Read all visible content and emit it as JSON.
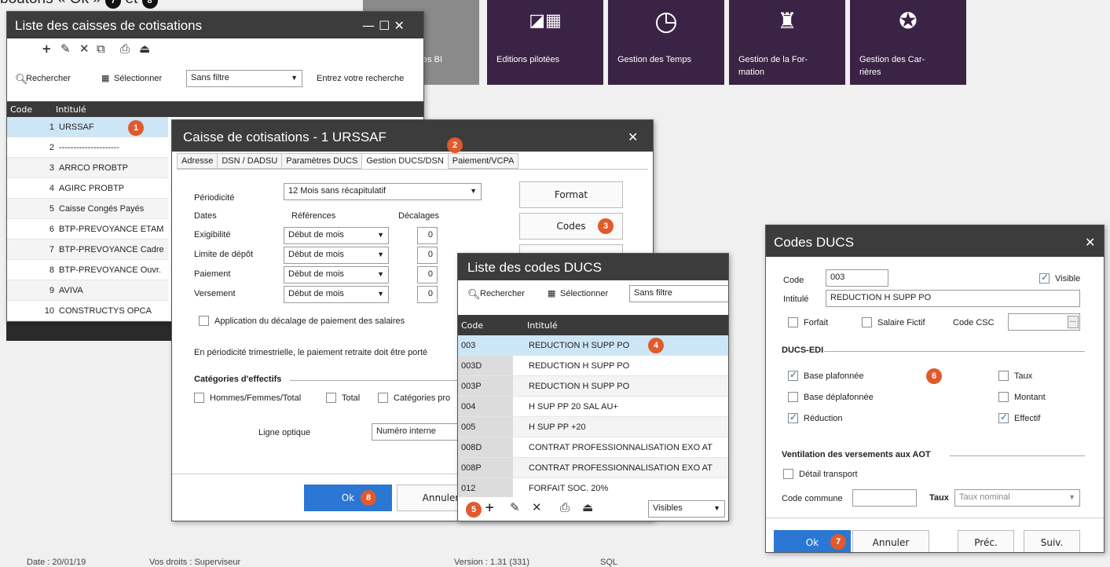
{
  "caption_top": "boutons « Ok »",
  "caption_badge_a": "7",
  "caption_et": "et",
  "caption_badge_b": "8",
  "tiles": [
    {
      "label": "es BI",
      "icon": ""
    },
    {
      "label": "Editions pilotées",
      "icon": "◪▦"
    },
    {
      "label": "Gestion des Temps",
      "icon": "◷"
    },
    {
      "label": "Gestion de la For- mation",
      "icon": "♜"
    },
    {
      "label": "Gestion des Car- rières",
      "icon": "✪"
    }
  ],
  "footer": {
    "date": "Date : 20/01/19",
    "rights": "Vos droits : Superviseur",
    "version": "Version : 1.31 (331)",
    "sql": "SQL"
  },
  "caisses": {
    "title": "Liste des caisses de cotisations",
    "win_controls": "— ☐ ✕",
    "search_label": "Rechercher",
    "select_label": "Sélectionner",
    "filter": "Sans filtre",
    "search_placeholder": "Entrez votre recherche",
    "col_code": "Code",
    "col_intitule": "Intitulé",
    "rows": [
      {
        "code": "1",
        "label": "URSSAF"
      },
      {
        "code": "2",
        "label": "---------------------"
      },
      {
        "code": "3",
        "label": "ARRCO PROBTP"
      },
      {
        "code": "4",
        "label": "AGIRC PROBTP"
      },
      {
        "code": "5",
        "label": "Caisse Congés Payés"
      },
      {
        "code": "6",
        "label": "BTP-PREVOYANCE ETAM"
      },
      {
        "code": "7",
        "label": "BTP-PREVOYANCE Cadre"
      },
      {
        "code": "8",
        "label": "BTP-PREVOYANCE Ouvr."
      },
      {
        "code": "9",
        "label": "AVIVA"
      },
      {
        "code": "10",
        "label": "CONSTRUCTYS OPCA"
      }
    ],
    "badge": "1"
  },
  "caisse_detail": {
    "title": "Caisse de cotisations - 1 URSSAF",
    "close": "✕",
    "tabs": [
      "Adresse",
      "DSN / DADSU",
      "Paramètres DUCS",
      "Gestion DUCS/DSN",
      "Paiement/VCPA"
    ],
    "badge_tab": "2",
    "periodicite_label": "Périodicité",
    "periodicite_value": "12 Mois sans récapitulatif",
    "dates_label": "Dates",
    "references_label": "Références",
    "decalages_label": "Décalages",
    "date_rows": [
      {
        "label": "Exigibilité",
        "ref": "Début de mois",
        "dec": "0"
      },
      {
        "label": "Limite de dépôt",
        "ref": "Début de mois",
        "dec": "0"
      },
      {
        "label": "Paiement",
        "ref": "Début de mois",
        "dec": "0"
      },
      {
        "label": "Versement",
        "ref": "Début de mois",
        "dec": "0"
      }
    ],
    "format_btn": "Format",
    "codes_btn": "Codes",
    "badge_codes": "3",
    "decalage_checkbox": "Application du décalage de paiement des salaires",
    "trimestrielle_text": "En périodicité trimestrielle, le paiement retraite doit être porté",
    "categories_title": "Catégories d'effectifs",
    "cat_hft": "Hommes/Femmes/Total",
    "cat_total": "Total",
    "cat_pro": "Catégories pro",
    "ligne_optique_label": "Ligne optique",
    "ligne_optique_value": "Numéro interne",
    "ok_btn": "Ok",
    "badge_ok": "8",
    "annuler_btn": "Annuler"
  },
  "codes_list": {
    "title": "Liste des codes DUCS",
    "search_label": "Rechercher",
    "select_label": "Sélectionner",
    "filter": "Sans filtre",
    "col_code": "Code",
    "col_intitule": "Intitulé",
    "rows": [
      {
        "code": "003",
        "label": "REDUCTION H SUPP PO"
      },
      {
        "code": "003D",
        "label": "REDUCTION H SUPP PO"
      },
      {
        "code": "003P",
        "label": "REDUCTION H SUPP PO"
      },
      {
        "code": "004",
        "label": "H SUP PP 20 SAL AU+"
      },
      {
        "code": "005",
        "label": "H SUP PP +20"
      },
      {
        "code": "008D",
        "label": "CONTRAT PROFESSIONNALISATION EXO AT"
      },
      {
        "code": "008P",
        "label": "CONTRAT PROFESSIONNALISATION EXO AT"
      },
      {
        "code": "012",
        "label": "FORFAIT SOC. 20%"
      }
    ],
    "badge_row": "4",
    "badge_tools": "5",
    "visibles": "Visibles"
  },
  "codes_ducs": {
    "title": "Codes DUCS",
    "close": "✕",
    "code_label": "Code",
    "code_value": "003",
    "visible_label": "Visible",
    "intitule_label": "Intitulé",
    "intitule_value": "REDUCTION H SUPP PO",
    "forfait_label": "Forfait",
    "salaire_fictif_label": "Salaire Fictif",
    "code_csc_label": "Code CSC",
    "ducs_edi_title": "DUCS-EDI",
    "base_plafonnee": "Base plafonnée",
    "base_deplafonnee": "Base déplafonnée",
    "reduction": "Réduction",
    "taux": "Taux",
    "montant": "Montant",
    "effectif": "Effectif",
    "badge": "6",
    "ventilation_title": "Ventilation des versements aux AOT",
    "detail_transport": "Détail transport",
    "code_commune_label": "Code commune",
    "taux_label": "Taux",
    "taux_value": "Taux nominal",
    "ok_btn": "Ok",
    "badge_ok": "7",
    "annuler_btn": "Annuler",
    "prec_btn": "Préc.",
    "suiv_btn": "Suiv."
  }
}
